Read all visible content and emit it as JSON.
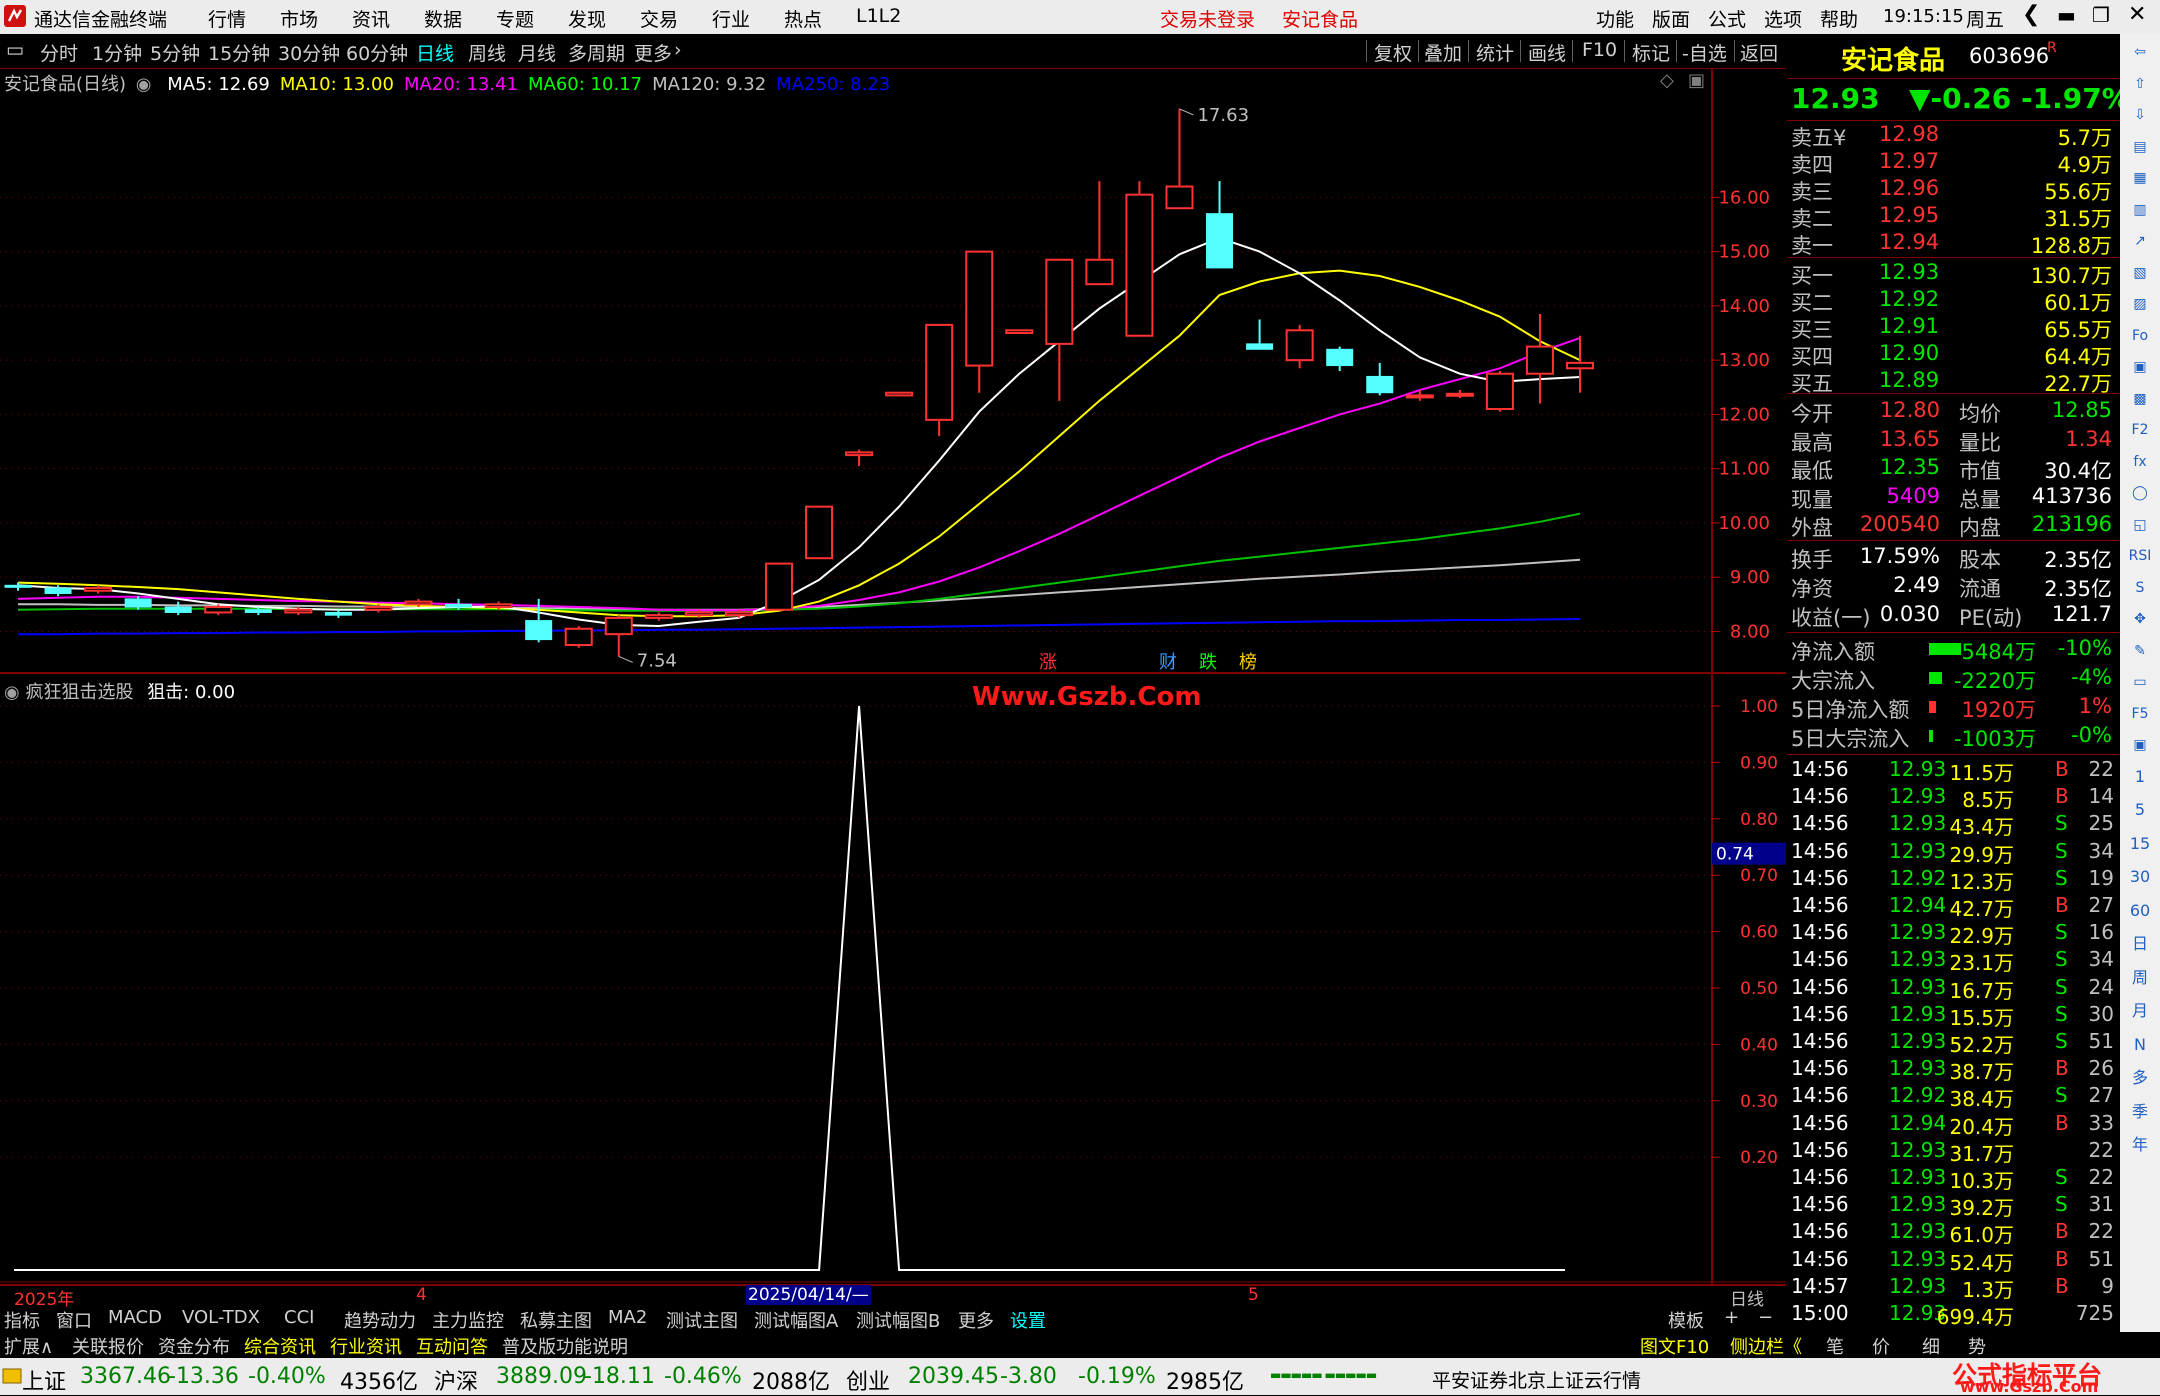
{
  "app": {
    "title": "通达信金融终端",
    "menu": [
      "行情",
      "市场",
      "资讯",
      "数据",
      "专题",
      "发现",
      "交易",
      "行业",
      "热点",
      "L1L2"
    ],
    "login_status": "交易未登录",
    "current_stock_tab": "安记食品",
    "right_menu": [
      "功能",
      "版面",
      "公式",
      "选项",
      "帮助"
    ],
    "time": "19:15:15",
    "weekday": "周五"
  },
  "toolbar": {
    "periods": [
      "分时",
      "1分钟",
      "5分钟",
      "15分钟",
      "30分钟",
      "60分钟",
      "日线",
      "周线",
      "月线",
      "多周期",
      "更多"
    ],
    "selected_period": "日线",
    "tools": [
      "复权",
      "叠加",
      "统计",
      "画线",
      "F10",
      "标记",
      "-自选",
      "返回"
    ]
  },
  "main_chart": {
    "legend_prefix": "安记食品(日线)",
    "ma": [
      {
        "label": "MA5: 12.69",
        "color": "#ffffff"
      },
      {
        "label": "MA10: 13.00",
        "color": "#ffff00"
      },
      {
        "label": "MA20: 13.41",
        "color": "#ff00ff"
      },
      {
        "label": "MA60: 10.17",
        "color": "#00ff00"
      },
      {
        "label": "MA120: 9.32",
        "color": "#c0c0c0"
      },
      {
        "label": "MA250: 8.23",
        "color": "#0000ff"
      }
    ],
    "high_label": "17.63",
    "low_label": "7.54",
    "y_ticks": [
      "16.00",
      "15.00",
      "14.00",
      "13.00",
      "12.00",
      "11.00",
      "10.00",
      "9.00",
      "8.00"
    ],
    "markers": [
      {
        "text": "涨",
        "color": "#ff3232"
      },
      {
        "text": "财",
        "color": "#3c9cff"
      },
      {
        "text": "跌",
        "color": "#00ff00"
      },
      {
        "text": "榜",
        "color": "#ffcc00"
      }
    ]
  },
  "chart_data": {
    "type": "candlestick",
    "title": "安记食品(日线)",
    "ylim": [
      7.4,
      18.2
    ],
    "candles": [
      {
        "o": 8.85,
        "c": 8.82,
        "h": 8.9,
        "l": 8.75
      },
      {
        "o": 8.8,
        "c": 8.7,
        "h": 8.85,
        "l": 8.65
      },
      {
        "o": 8.75,
        "c": 8.8,
        "h": 8.85,
        "l": 8.7
      },
      {
        "o": 8.6,
        "c": 8.45,
        "h": 8.65,
        "l": 8.4
      },
      {
        "o": 8.45,
        "c": 8.35,
        "h": 8.55,
        "l": 8.3
      },
      {
        "o": 8.35,
        "c": 8.45,
        "h": 8.5,
        "l": 8.3
      },
      {
        "o": 8.4,
        "c": 8.35,
        "h": 8.45,
        "l": 8.3
      },
      {
        "o": 8.35,
        "c": 8.4,
        "h": 8.45,
        "l": 8.3
      },
      {
        "o": 8.35,
        "c": 8.3,
        "h": 8.4,
        "l": 8.25
      },
      {
        "o": 8.4,
        "c": 8.45,
        "h": 8.5,
        "l": 8.35
      },
      {
        "o": 8.5,
        "c": 8.55,
        "h": 8.6,
        "l": 8.45
      },
      {
        "o": 8.5,
        "c": 8.45,
        "h": 8.6,
        "l": 8.4
      },
      {
        "o": 8.45,
        "c": 8.5,
        "h": 8.55,
        "l": 8.4
      },
      {
        "o": 8.2,
        "c": 7.85,
        "h": 8.6,
        "l": 7.8
      },
      {
        "o": 7.75,
        "c": 8.05,
        "h": 8.1,
        "l": 7.7
      },
      {
        "o": 7.95,
        "c": 8.25,
        "h": 8.3,
        "l": 7.54
      },
      {
        "o": 8.25,
        "c": 8.3,
        "h": 8.35,
        "l": 8.2
      },
      {
        "o": 8.3,
        "c": 8.35,
        "h": 8.4,
        "l": 8.25
      },
      {
        "o": 8.3,
        "c": 8.35,
        "h": 8.4,
        "l": 8.25
      },
      {
        "o": 8.4,
        "c": 9.25,
        "h": 9.25,
        "l": 8.4
      },
      {
        "o": 9.35,
        "c": 10.3,
        "h": 10.3,
        "l": 9.35
      },
      {
        "o": 11.25,
        "c": 11.3,
        "h": 11.35,
        "l": 11.05
      },
      {
        "o": 12.35,
        "c": 12.4,
        "h": 12.4,
        "l": 12.35
      },
      {
        "o": 11.9,
        "c": 13.65,
        "h": 13.65,
        "l": 11.6
      },
      {
        "o": 12.9,
        "c": 15.0,
        "h": 15.0,
        "l": 12.4
      },
      {
        "o": 13.5,
        "c": 13.55,
        "h": 13.55,
        "l": 13.5
      },
      {
        "o": 13.3,
        "c": 14.85,
        "h": 14.85,
        "l": 12.25
      },
      {
        "o": 14.4,
        "c": 14.85,
        "h": 16.3,
        "l": 14.4
      },
      {
        "o": 13.45,
        "c": 16.05,
        "h": 16.3,
        "l": 13.45
      },
      {
        "o": 15.8,
        "c": 16.2,
        "h": 17.63,
        "l": 15.8
      },
      {
        "o": 15.7,
        "c": 14.7,
        "h": 16.3,
        "l": 14.7
      },
      {
        "o": 13.3,
        "c": 13.2,
        "h": 13.75,
        "l": 13.2
      },
      {
        "o": 13.0,
        "c": 13.55,
        "h": 13.65,
        "l": 12.85
      },
      {
        "o": 13.2,
        "c": 12.9,
        "h": 13.25,
        "l": 12.8
      },
      {
        "o": 12.7,
        "c": 12.4,
        "h": 12.95,
        "l": 12.35
      },
      {
        "o": 12.35,
        "c": 12.35,
        "h": 12.45,
        "l": 12.25
      },
      {
        "o": 12.38,
        "c": 12.38,
        "h": 12.45,
        "l": 12.3
      },
      {
        "o": 12.1,
        "c": 12.75,
        "h": 12.8,
        "l": 12.05
      },
      {
        "o": 12.75,
        "c": 13.25,
        "h": 13.85,
        "l": 12.2
      },
      {
        "o": 12.85,
        "c": 12.95,
        "h": 13.45,
        "l": 12.4
      }
    ],
    "ma5": [
      8.85,
      8.8,
      8.78,
      8.7,
      8.6,
      8.5,
      8.45,
      8.42,
      8.4,
      8.4,
      8.43,
      8.45,
      8.46,
      8.35,
      8.22,
      8.12,
      8.1,
      8.18,
      8.25,
      8.55,
      8.95,
      9.55,
      10.3,
      11.15,
      12.05,
      12.75,
      13.35,
      13.95,
      14.45,
      14.95,
      15.25,
      15.0,
      14.6,
      14.1,
      13.55,
      13.05,
      12.75,
      12.6,
      12.65,
      12.69
    ],
    "ma10": [
      8.9,
      8.88,
      8.85,
      8.82,
      8.78,
      8.72,
      8.66,
      8.6,
      8.55,
      8.5,
      8.47,
      8.45,
      8.43,
      8.4,
      8.35,
      8.3,
      8.28,
      8.28,
      8.3,
      8.38,
      8.55,
      8.85,
      9.25,
      9.75,
      10.35,
      10.95,
      11.6,
      12.25,
      12.85,
      13.45,
      14.2,
      14.45,
      14.6,
      14.65,
      14.55,
      14.35,
      14.1,
      13.8,
      13.35,
      13.0
    ],
    "ma20": [
      8.6,
      8.62,
      8.64,
      8.64,
      8.62,
      8.6,
      8.58,
      8.56,
      8.55,
      8.53,
      8.52,
      8.5,
      8.49,
      8.47,
      8.45,
      8.43,
      8.4,
      8.39,
      8.39,
      8.42,
      8.47,
      8.58,
      8.72,
      8.92,
      9.18,
      9.48,
      9.8,
      10.15,
      10.5,
      10.85,
      11.2,
      11.5,
      11.75,
      12.0,
      12.2,
      12.45,
      12.65,
      12.85,
      13.15,
      13.41
    ],
    "ma60": [
      8.4,
      8.41,
      8.42,
      8.42,
      8.42,
      8.42,
      8.42,
      8.41,
      8.41,
      8.41,
      8.41,
      8.41,
      8.41,
      8.4,
      8.39,
      8.38,
      8.38,
      8.38,
      8.38,
      8.4,
      8.42,
      8.46,
      8.52,
      8.6,
      8.7,
      8.8,
      8.9,
      9.0,
      9.1,
      9.2,
      9.3,
      9.38,
      9.46,
      9.54,
      9.62,
      9.7,
      9.8,
      9.9,
      10.02,
      10.17
    ],
    "ma120": [
      8.5,
      8.5,
      8.49,
      8.49,
      8.48,
      8.48,
      8.47,
      8.47,
      8.46,
      8.46,
      8.45,
      8.45,
      8.44,
      8.43,
      8.42,
      8.41,
      8.4,
      8.4,
      8.4,
      8.42,
      8.45,
      8.49,
      8.53,
      8.57,
      8.62,
      8.67,
      8.72,
      8.77,
      8.82,
      8.87,
      8.92,
      8.97,
      9.01,
      9.05,
      9.1,
      9.14,
      9.18,
      9.22,
      9.27,
      9.32
    ],
    "ma250": [
      7.95,
      7.95,
      7.96,
      7.96,
      7.97,
      7.97,
      7.98,
      7.98,
      7.99,
      7.99,
      8.0,
      8.0,
      8.01,
      8.01,
      8.02,
      8.02,
      8.03,
      8.03,
      8.04,
      8.05,
      8.06,
      8.07,
      8.08,
      8.09,
      8.1,
      8.11,
      8.12,
      8.13,
      8.14,
      8.15,
      8.16,
      8.17,
      8.18,
      8.19,
      8.19,
      8.2,
      8.21,
      8.21,
      8.22,
      8.23
    ]
  },
  "sub_chart": {
    "title": "疯狂狙击选股",
    "value_label": "狙击: 0.00",
    "watermark": "Www.Gszb.Com",
    "y_ticks": [
      "1.00",
      "0.90",
      "0.80",
      "0.70",
      "0.60",
      "0.50",
      "0.40",
      "0.30",
      "0.20"
    ],
    "cursor_value": "0.74",
    "x_labels": [
      "2025年",
      "4",
      "2025/04/14/—",
      "5"
    ],
    "period_label": "日线",
    "signal": {
      "spike_index": 21,
      "values_note_hidden": true
    }
  },
  "quote": {
    "name": "安记食品",
    "code": "603696",
    "badge": "R",
    "price": "12.93",
    "change": "▼-0.26",
    "change_pct": "-1.97%",
    "asks": [
      {
        "label": "卖五",
        "flag": "¥",
        "price": "12.98",
        "vol": "5.7万"
      },
      {
        "label": "卖四",
        "flag": "",
        "price": "12.97",
        "vol": "4.9万"
      },
      {
        "label": "卖三",
        "flag": "",
        "price": "12.96",
        "vol": "55.6万"
      },
      {
        "label": "卖二",
        "flag": "",
        "price": "12.95",
        "vol": "31.5万"
      },
      {
        "label": "卖一",
        "flag": "",
        "price": "12.94",
        "vol": "128.8万"
      }
    ],
    "bids": [
      {
        "label": "买一",
        "price": "12.93",
        "vol": "130.7万"
      },
      {
        "label": "买二",
        "price": "12.92",
        "vol": "60.1万"
      },
      {
        "label": "买三",
        "price": "12.91",
        "vol": "65.5万"
      },
      {
        "label": "买四",
        "price": "12.90",
        "vol": "64.4万"
      },
      {
        "label": "买五",
        "price": "12.89",
        "vol": "22.7万"
      }
    ],
    "stats1": [
      {
        "l1": "今开",
        "v1": "12.80",
        "c1": "up",
        "l2": "均价",
        "v2": "12.85",
        "c2": "dn"
      },
      {
        "l1": "最高",
        "v1": "13.65",
        "c1": "up",
        "l2": "量比",
        "v2": "1.34",
        "c2": "up"
      },
      {
        "l1": "最低",
        "v1": "12.35",
        "c1": "dn",
        "l2": "市值",
        "v2": "30.4亿",
        "c2": "wht"
      },
      {
        "l1": "现量",
        "v1": "5409",
        "c1": "mag",
        "l2": "总量",
        "v2": "413736",
        "c2": "wht"
      },
      {
        "l1": "外盘",
        "v1": "200540",
        "c1": "up",
        "l2": "内盘",
        "v2": "213196",
        "c2": "dn"
      }
    ],
    "stats2": [
      {
        "l1": "换手",
        "v1": "17.59%",
        "l2": "股本",
        "v2": "2.35亿"
      },
      {
        "l1": "净资",
        "v1": "2.49",
        "l2": "流通",
        "v2": "2.35亿"
      },
      {
        "l1": "收益(一)",
        "v1": "0.030",
        "l2": "PE(动)",
        "v2": "121.7"
      }
    ],
    "flows": [
      {
        "label": "净流入额",
        "value": "-5484万",
        "pct": "-10%",
        "bar_frac": 0.9,
        "color": "dn"
      },
      {
        "label": "大宗流入",
        "value": "-2220万",
        "pct": "-4%",
        "bar_frac": 0.36,
        "color": "dn"
      },
      {
        "label": "5日净流入额",
        "value": "1920万",
        "pct": "1%",
        "bar_frac": 0.2,
        "color": "up"
      },
      {
        "label": "5日大宗流入",
        "value": "-1003万",
        "pct": "-0%",
        "bar_frac": 0.1,
        "color": "dn"
      }
    ],
    "ticks": [
      {
        "t": "14:56",
        "p": "12.93",
        "v": "11.5万",
        "s": "B",
        "n": "22"
      },
      {
        "t": "14:56",
        "p": "12.93",
        "v": "8.5万",
        "s": "B",
        "n": "14"
      },
      {
        "t": "14:56",
        "p": "12.93",
        "v": "43.4万",
        "s": "S",
        "n": "25"
      },
      {
        "t": "14:56",
        "p": "12.93",
        "v": "29.9万",
        "s": "S",
        "n": "34"
      },
      {
        "t": "14:56",
        "p": "12.92",
        "v": "12.3万",
        "s": "S",
        "n": "19"
      },
      {
        "t": "14:56",
        "p": "12.94",
        "v": "42.7万",
        "s": "B",
        "n": "27"
      },
      {
        "t": "14:56",
        "p": "12.93",
        "v": "22.9万",
        "s": "S",
        "n": "16"
      },
      {
        "t": "14:56",
        "p": "12.93",
        "v": "23.1万",
        "s": "S",
        "n": "34"
      },
      {
        "t": "14:56",
        "p": "12.93",
        "v": "16.7万",
        "s": "S",
        "n": "24"
      },
      {
        "t": "14:56",
        "p": "12.93",
        "v": "15.5万",
        "s": "S",
        "n": "30"
      },
      {
        "t": "14:56",
        "p": "12.93",
        "v": "52.2万",
        "s": "S",
        "n": "51"
      },
      {
        "t": "14:56",
        "p": "12.93",
        "v": "38.7万",
        "s": "B",
        "n": "26"
      },
      {
        "t": "14:56",
        "p": "12.92",
        "v": "38.4万",
        "s": "S",
        "n": "27"
      },
      {
        "t": "14:56",
        "p": "12.94",
        "v": "20.4万",
        "s": "B",
        "n": "33"
      },
      {
        "t": "14:56",
        "p": "12.93",
        "v": "31.7万",
        "s": "",
        "n": "22"
      },
      {
        "t": "14:56",
        "p": "12.93",
        "v": "10.3万",
        "s": "S",
        "n": "22"
      },
      {
        "t": "14:56",
        "p": "12.93",
        "v": "39.2万",
        "s": "S",
        "n": "31"
      },
      {
        "t": "14:56",
        "p": "12.93",
        "v": "61.0万",
        "s": "B",
        "n": "22"
      },
      {
        "t": "14:56",
        "p": "12.93",
        "v": "52.4万",
        "s": "B",
        "n": "51"
      },
      {
        "t": "14:57",
        "p": "12.93",
        "v": "1.3万",
        "s": "B",
        "n": "9"
      },
      {
        "t": "15:00",
        "p": "12.93",
        "v": "699.4万",
        "s": "",
        "n": "725"
      }
    ]
  },
  "side_icons": [
    "⇦",
    "⇧",
    "⇩",
    "▤",
    "▦",
    "▥",
    "↗",
    "▧",
    "▨",
    "Fo",
    "▣",
    "▩",
    "F2",
    "fx",
    "◯",
    "◱",
    "RSI",
    "S",
    "✥",
    "✎",
    "▭",
    "F5",
    "▣",
    "1",
    "5",
    "15",
    "30",
    "60",
    "日",
    "周",
    "月",
    "N",
    "多",
    "季",
    "年"
  ],
  "bottom_tabs1": [
    "指标",
    "窗口",
    "MACD",
    "VOL-TDX",
    "CCI",
    "趋势动力",
    "主力监控",
    "私募主图",
    "MA2",
    "测试主图",
    "测试幅图A",
    "测试幅图B",
    "更多",
    "设置",
    "模板",
    "+",
    "−"
  ],
  "bottom_tabs2": [
    "扩展∧",
    "关联报价",
    "资金分布",
    "综合资讯",
    "行业资讯",
    "互动问答",
    "普及版功能说明"
  ],
  "bottom_right_tabs": [
    "图文F10",
    "侧边栏《",
    "笔",
    "价",
    "细",
    "势"
  ],
  "status": {
    "indices": [
      {
        "name": "上证",
        "val": "3367.46",
        "chg": "-13.36",
        "pct": "-0.40%",
        "amt": "4356亿"
      },
      {
        "name": "沪深",
        "val": "3889.09",
        "chg": "-18.11",
        "pct": "-0.46%",
        "amt": "2088亿"
      },
      {
        "name": "创业",
        "val": "2039.45",
        "chg": "-3.80",
        "pct": "-0.19%",
        "amt": "2985亿"
      }
    ],
    "broker": "平安证券北京上证云行情",
    "brand": "公式指标平台",
    "brand_url": "www.Gszb.Com"
  }
}
